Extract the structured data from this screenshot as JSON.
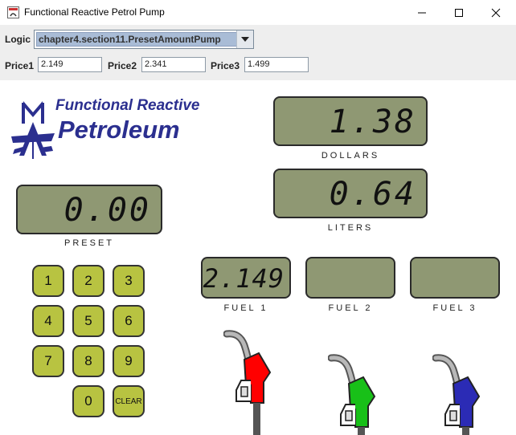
{
  "window": {
    "title": "Functional Reactive Petrol Pump"
  },
  "logic": {
    "label": "Logic",
    "selected": "chapter4.section11.PresetAmountPump"
  },
  "prices": [
    {
      "label": "Price1",
      "value": "2.149"
    },
    {
      "label": "Price2",
      "value": "2.341"
    },
    {
      "label": "Price3",
      "value": "1.499"
    }
  ],
  "logo": {
    "line1": "Functional Reactive",
    "line2": "Petroleum",
    "color": "#2b2f8f"
  },
  "displays": {
    "dollars": {
      "value": "1.38",
      "label": "DOLLARS"
    },
    "liters": {
      "value": "0.64",
      "label": "LITERS"
    },
    "preset": {
      "value": "0.00",
      "label": "PRESET"
    },
    "fuel1": {
      "value": "2.149",
      "label": "FUEL 1"
    },
    "fuel2": {
      "value": "",
      "label": "FUEL 2"
    },
    "fuel3": {
      "value": "",
      "label": "FUEL 3"
    }
  },
  "keypad": [
    "1",
    "2",
    "3",
    "4",
    "5",
    "6",
    "7",
    "8",
    "9",
    "0",
    "CLEAR"
  ],
  "nozzles": [
    {
      "name": "nozzle-1",
      "color": "#ff0000"
    },
    {
      "name": "nozzle-2",
      "color": "#18c018"
    },
    {
      "name": "nozzle-3",
      "color": "#2b2bb5"
    }
  ],
  "colors": {
    "lcd": "#8f9873",
    "key": "#b8c341",
    "combo_selection": "#a9bcd6"
  }
}
